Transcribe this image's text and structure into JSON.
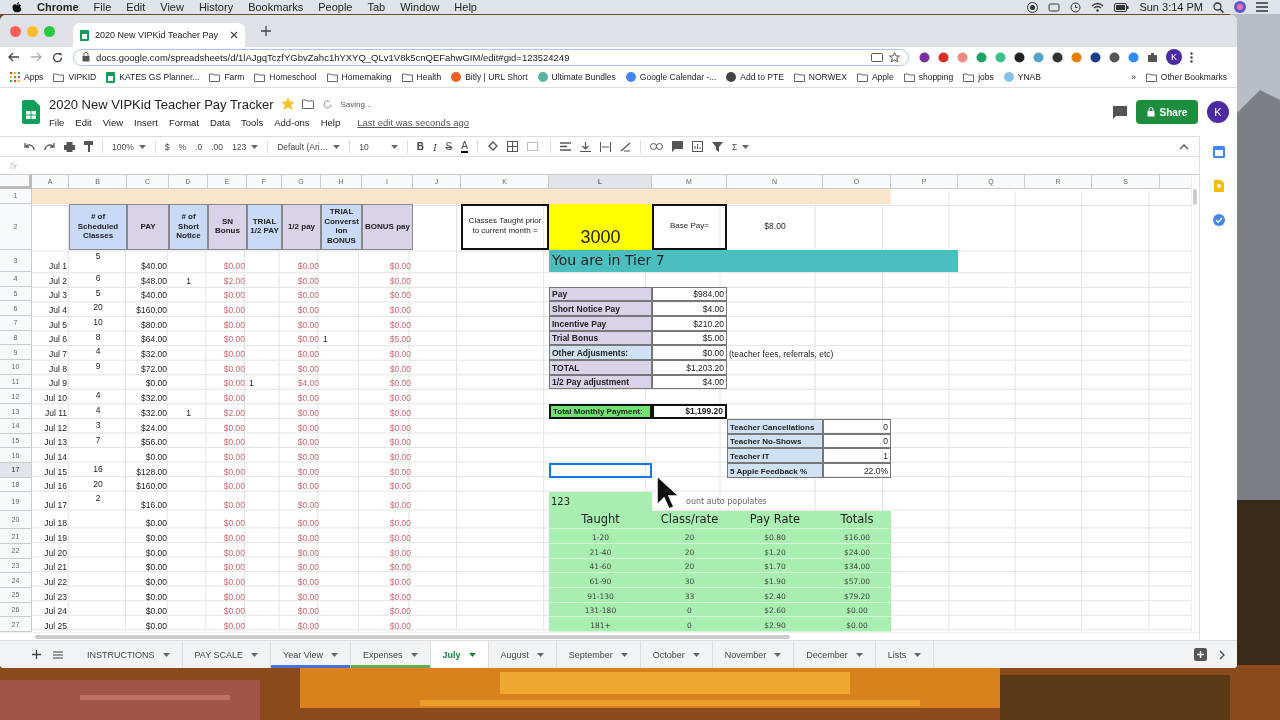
{
  "menubar": {
    "app": "Chrome",
    "items": [
      "File",
      "Edit",
      "View",
      "History",
      "Bookmarks",
      "People",
      "Tab",
      "Window",
      "Help"
    ],
    "clock": "Sun 3:14 PM"
  },
  "browser": {
    "tab_title": "2020 New VIPKid Teacher Pay",
    "url": "docs.google.com/spreadsheets/d/1lAJgqTczfYGbvZahc1hYXYQ_QLv1V8k5cnQEFahwGIM/edit#gid=123524249",
    "profile": "K",
    "bookmarks": [
      {
        "label": "Apps",
        "kind": "apps"
      },
      {
        "label": "VIPKID",
        "kind": "folder"
      },
      {
        "label": "KATES GS Planner...",
        "kind": "sheet"
      },
      {
        "label": "Farm",
        "kind": "folder"
      },
      {
        "label": "Homeschool",
        "kind": "folder"
      },
      {
        "label": "Homemaking",
        "kind": "folder"
      },
      {
        "label": "Health",
        "kind": "folder"
      },
      {
        "label": "Bitly | URL Short",
        "kind": "site",
        "color": "#ee6123"
      },
      {
        "label": "Ultimate Bundles",
        "kind": "site",
        "color": "#5bb5a2"
      },
      {
        "label": "Google Calendar -...",
        "kind": "site",
        "color": "#4285f4"
      },
      {
        "label": "Add to PTE",
        "kind": "site",
        "color": "#444444"
      },
      {
        "label": "NORWEX",
        "kind": "folder"
      },
      {
        "label": "Apple",
        "kind": "folder"
      },
      {
        "label": "shopping",
        "kind": "folder"
      },
      {
        "label": "jobs",
        "kind": "folder"
      },
      {
        "label": "YNAB",
        "kind": "site",
        "color": "#85c3e9"
      }
    ],
    "more": "»",
    "other_bookmarks": "Other Bookmarks"
  },
  "doc": {
    "title": "2020 New VIPKid Teacher Pay Tracker",
    "starred": true,
    "status": "Saving...",
    "menus": [
      "File",
      "Edit",
      "View",
      "Insert",
      "Format",
      "Data",
      "Tools",
      "Add-ons",
      "Help"
    ],
    "last_edit": "Last edit was seconds ago",
    "share": "Share",
    "avatar": "K"
  },
  "toolbar": {
    "zoom": "100%",
    "currency": "$",
    "percent": "%",
    "decrease_decimals": ".0",
    "increase_decimals": ".00",
    "number_format": "123",
    "font": "Default (Ari…",
    "font_size": "10",
    "bold": "B",
    "italic": "I",
    "strikethrough": "S",
    "text_color": "A",
    "functions": "Σ"
  },
  "formula_bar": {
    "label": "fx"
  },
  "sheet": {
    "columns": [
      {
        "label": "A",
        "selected": false
      },
      {
        "label": "B",
        "selected": false
      },
      {
        "label": "C",
        "selected": false
      },
      {
        "label": "D",
        "selected": false
      },
      {
        "label": "E",
        "selected": false
      },
      {
        "label": "F",
        "selected": false
      },
      {
        "label": "G",
        "selected": false
      },
      {
        "label": "H",
        "selected": false
      },
      {
        "label": "I",
        "selected": false
      },
      {
        "label": "J",
        "selected": false
      },
      {
        "label": "K",
        "selected": false
      },
      {
        "label": "L",
        "selected": true
      },
      {
        "label": "M",
        "selected": false
      },
      {
        "label": "N",
        "selected": false
      },
      {
        "label": "O",
        "selected": false
      },
      {
        "label": "P",
        "selected": false
      },
      {
        "label": "Q",
        "selected": false
      },
      {
        "label": "R",
        "selected": false
      },
      {
        "label": "S",
        "selected": false
      }
    ],
    "rows": [
      {
        "label": "1",
        "selected": false
      },
      {
        "label": "2",
        "selected": false
      },
      {
        "label": "3",
        "selected": false
      },
      {
        "label": "4",
        "selected": false
      },
      {
        "label": "5",
        "selected": false
      },
      {
        "label": "6",
        "selected": false
      },
      {
        "label": "7",
        "selected": false
      },
      {
        "label": "8",
        "selected": false
      },
      {
        "label": "9",
        "selected": false
      },
      {
        "label": "10",
        "selected": false
      },
      {
        "label": "11",
        "selected": false
      },
      {
        "label": "12",
        "selected": false
      },
      {
        "label": "13",
        "selected": false
      },
      {
        "label": "14",
        "selected": false
      },
      {
        "label": "15",
        "selected": false
      },
      {
        "label": "16",
        "selected": false
      },
      {
        "label": "17",
        "selected": true
      },
      {
        "label": "18",
        "selected": false
      },
      {
        "label": "19",
        "selected": false
      },
      {
        "label": "20",
        "selected": false
      },
      {
        "label": "21",
        "selected": false
      },
      {
        "label": "22",
        "selected": false
      },
      {
        "label": "23",
        "selected": false
      },
      {
        "label": "24",
        "selected": false
      },
      {
        "label": "25",
        "selected": false
      },
      {
        "label": "26",
        "selected": false
      },
      {
        "label": "27",
        "selected": false
      }
    ]
  },
  "daily": {
    "header": [
      {
        "label": "# of Scheduled Classes",
        "color": "#c9daf8"
      },
      {
        "label": "PAY",
        "color": "#d9d2e9"
      },
      {
        "label": "# of Short Notice",
        "color": "#c9daf8"
      },
      {
        "label": "SN Bonus",
        "color": "#d9d2e9"
      },
      {
        "label": "TRIAL 1/2 PAY",
        "color": "#c9daf8"
      },
      {
        "label": "1/2 pay",
        "color": "#d9d2e9"
      },
      {
        "label": "TRIAL Converstion BONUS",
        "color": "#c9daf8"
      },
      {
        "label": "BONUS pay",
        "color": "#d9d2e9"
      }
    ],
    "rows": [
      {
        "date": "Jul 1",
        "classes": "5",
        "pay": "$40.00",
        "sn_bonus": "$0.00",
        "half_pay": "$0.00",
        "bonus": "$0.00"
      },
      {
        "date": "Jul 2",
        "classes": "6",
        "pay": "$48.00",
        "short_notice": "1",
        "sn_bonus": "$2.00",
        "half_pay": "$0.00",
        "bonus": "$0.00"
      },
      {
        "date": "Jul 3",
        "classes": "5",
        "pay": "$40.00",
        "sn_bonus": "$0.00",
        "half_pay": "$0.00",
        "bonus": "$0.00"
      },
      {
        "date": "Jul 4",
        "classes": "20",
        "pay": "$160.00",
        "sn_bonus": "$0.00",
        "half_pay": "$0.00",
        "bonus": "$0.00"
      },
      {
        "date": "Jul 5",
        "classes": "10",
        "pay": "$80.00",
        "sn_bonus": "$0.00",
        "half_pay": "$0.00",
        "bonus": "$0.00"
      },
      {
        "date": "Jul 6",
        "classes": "8",
        "pay": "$64.00",
        "sn_bonus": "$0.00",
        "half_pay": "$0.00",
        "trial_conversion": "1",
        "bonus": "$5.00"
      },
      {
        "date": "Jul 7",
        "classes": "4",
        "pay": "$32.00",
        "sn_bonus": "$0.00",
        "half_pay": "$0.00",
        "bonus": "$0.00"
      },
      {
        "date": "Jul 8",
        "classes": "9",
        "pay": "$72.00",
        "sn_bonus": "$0.00",
        "half_pay": "$0.00",
        "bonus": "$0.00"
      },
      {
        "date": "Jul 9",
        "pay": "$0.00",
        "sn_bonus": "$0.00",
        "trial_half_pay": "1",
        "half_pay": "$4.00",
        "bonus": "$0.00"
      },
      {
        "date": "Jul 10",
        "classes": "4",
        "pay": "$32.00",
        "sn_bonus": "$0.00",
        "half_pay": "$0.00",
        "bonus": "$0.00"
      },
      {
        "date": "Jul 11",
        "classes": "4",
        "pay": "$32.00",
        "short_notice": "1",
        "sn_bonus": "$2.00",
        "half_pay": "$0.00",
        "bonus": "$0.00"
      },
      {
        "date": "Jul 12",
        "classes": "3",
        "pay": "$24.00",
        "sn_bonus": "$0.00",
        "half_pay": "$0.00",
        "bonus": "$0.00"
      },
      {
        "date": "Jul 13",
        "classes": "7",
        "pay": "$56.00",
        "sn_bonus": "$0.00",
        "half_pay": "$0.00",
        "bonus": "$0.00"
      },
      {
        "date": "Jul 14",
        "pay": "$0.00",
        "sn_bonus": "$0.00",
        "half_pay": "$0.00",
        "bonus": "$0.00"
      },
      {
        "date": "Jul 15",
        "classes": "16",
        "pay": "$128.00",
        "sn_bonus": "$0.00",
        "half_pay": "$0.00",
        "bonus": "$0.00"
      },
      {
        "date": "Jul 16",
        "classes": "20",
        "pay": "$160.00",
        "sn_bonus": "$0.00",
        "half_pay": "$0.00",
        "bonus": "$0.00"
      },
      {
        "date": "Jul 17",
        "classes": "2",
        "pay": "$16.00",
        "sn_bonus": "$0.00",
        "half_pay": "$0.00",
        "bonus": "$0.00"
      },
      {
        "date": "Jul 18",
        "pay": "$0.00",
        "sn_bonus": "$0.00",
        "half_pay": "$0.00",
        "bonus": "$0.00"
      },
      {
        "date": "Jul 19",
        "pay": "$0.00",
        "sn_bonus": "$0.00",
        "half_pay": "$0.00",
        "bonus": "$0.00"
      },
      {
        "date": "Jul 20",
        "pay": "$0.00",
        "sn_bonus": "$0.00",
        "half_pay": "$0.00",
        "bonus": "$0.00"
      },
      {
        "date": "Jul 21",
        "pay": "$0.00",
        "sn_bonus": "$0.00",
        "half_pay": "$0.00",
        "bonus": "$0.00"
      },
      {
        "date": "Jul 22",
        "pay": "$0.00",
        "sn_bonus": "$0.00",
        "half_pay": "$0.00",
        "bonus": "$0.00"
      },
      {
        "date": "Jul 23",
        "pay": "$0.00",
        "sn_bonus": "$0.00",
        "half_pay": "$0.00",
        "bonus": "$0.00"
      },
      {
        "date": "Jul 24",
        "pay": "$0.00",
        "sn_bonus": "$0.00",
        "half_pay": "$0.00",
        "bonus": "$0.00"
      },
      {
        "date": "Jul 25",
        "pay": "$0.00",
        "sn_bonus": "$0.00",
        "half_pay": "$0.00",
        "bonus": "$0.00"
      }
    ]
  },
  "prior_classes": {
    "label": "Classes Taught prior to current month =",
    "value": "3000"
  },
  "base_pay": {
    "label": "Base Pay=",
    "value": "$8.00"
  },
  "tier_banner": "You are in Tier 7",
  "summary": [
    {
      "label": "Pay",
      "value": "$984.00",
      "color": "#d9d2e9"
    },
    {
      "label": "Short Notice Pay",
      "value": "$4.00",
      "color": "#d9d2e9"
    },
    {
      "label": "Incentive Pay",
      "value": "$210.20",
      "color": "#d9d2e9"
    },
    {
      "label": "Trial Bonus",
      "value": "$5.00",
      "color": "#d9d2e9"
    },
    {
      "label": "Other Adjusments:",
      "value": "$0.00",
      "color": "#cfe2f3",
      "note": "(teacher fees, referrals, etc)"
    },
    {
      "label": "TOTAL",
      "value": "$1,203.20",
      "color": "#d9d2e9"
    },
    {
      "label": "1/2 Pay adjustment",
      "value": "$4.00",
      "color": "#d9d2e9"
    }
  ],
  "total": {
    "label": "Total Monthly Payment:",
    "value": "$1,199.20"
  },
  "teacher_stats": [
    {
      "label": "Teacher Cancellations",
      "value": "0"
    },
    {
      "label": "Teacher No-Shows",
      "value": "0"
    },
    {
      "label": "Teacher IT",
      "value": "1"
    },
    {
      "label": "5 Apple Feedback %",
      "value": "22.0%"
    }
  ],
  "tiers": {
    "count": "123",
    "note": "ount auto populates",
    "columns": [
      "Taught",
      "Class/rate",
      "Pay Rate",
      "Totals"
    ],
    "rows": [
      [
        "1-20",
        "20",
        "$0.80",
        "$16.00"
      ],
      [
        "21-40",
        "20",
        "$1.20",
        "$24.00"
      ],
      [
        "41-60",
        "20",
        "$1.70",
        "$34.00"
      ],
      [
        "61-90",
        "30",
        "$1.90",
        "$57.00"
      ],
      [
        "91-130",
        "33",
        "$2.40",
        "$79.20"
      ],
      [
        "131-180",
        "0",
        "$2.60",
        "$0.00"
      ],
      [
        "181+",
        "0",
        "$2.90",
        "$0.00"
      ]
    ]
  },
  "sheet_tabs": [
    {
      "label": "INSTRUCTIONS",
      "selected": false
    },
    {
      "label": "PAY SCALE",
      "selected": false
    },
    {
      "label": "Year View",
      "selected": false,
      "color": "#4a6fdc"
    },
    {
      "label": "Expenses",
      "selected": false,
      "color": "#6aa84f"
    },
    {
      "label": "July",
      "selected": true
    },
    {
      "label": "August",
      "selected": false
    },
    {
      "label": "September",
      "selected": false
    },
    {
      "label": "October",
      "selected": false
    },
    {
      "label": "November",
      "selected": false
    },
    {
      "label": "December",
      "selected": false
    },
    {
      "label": "Lists",
      "selected": false
    }
  ]
}
